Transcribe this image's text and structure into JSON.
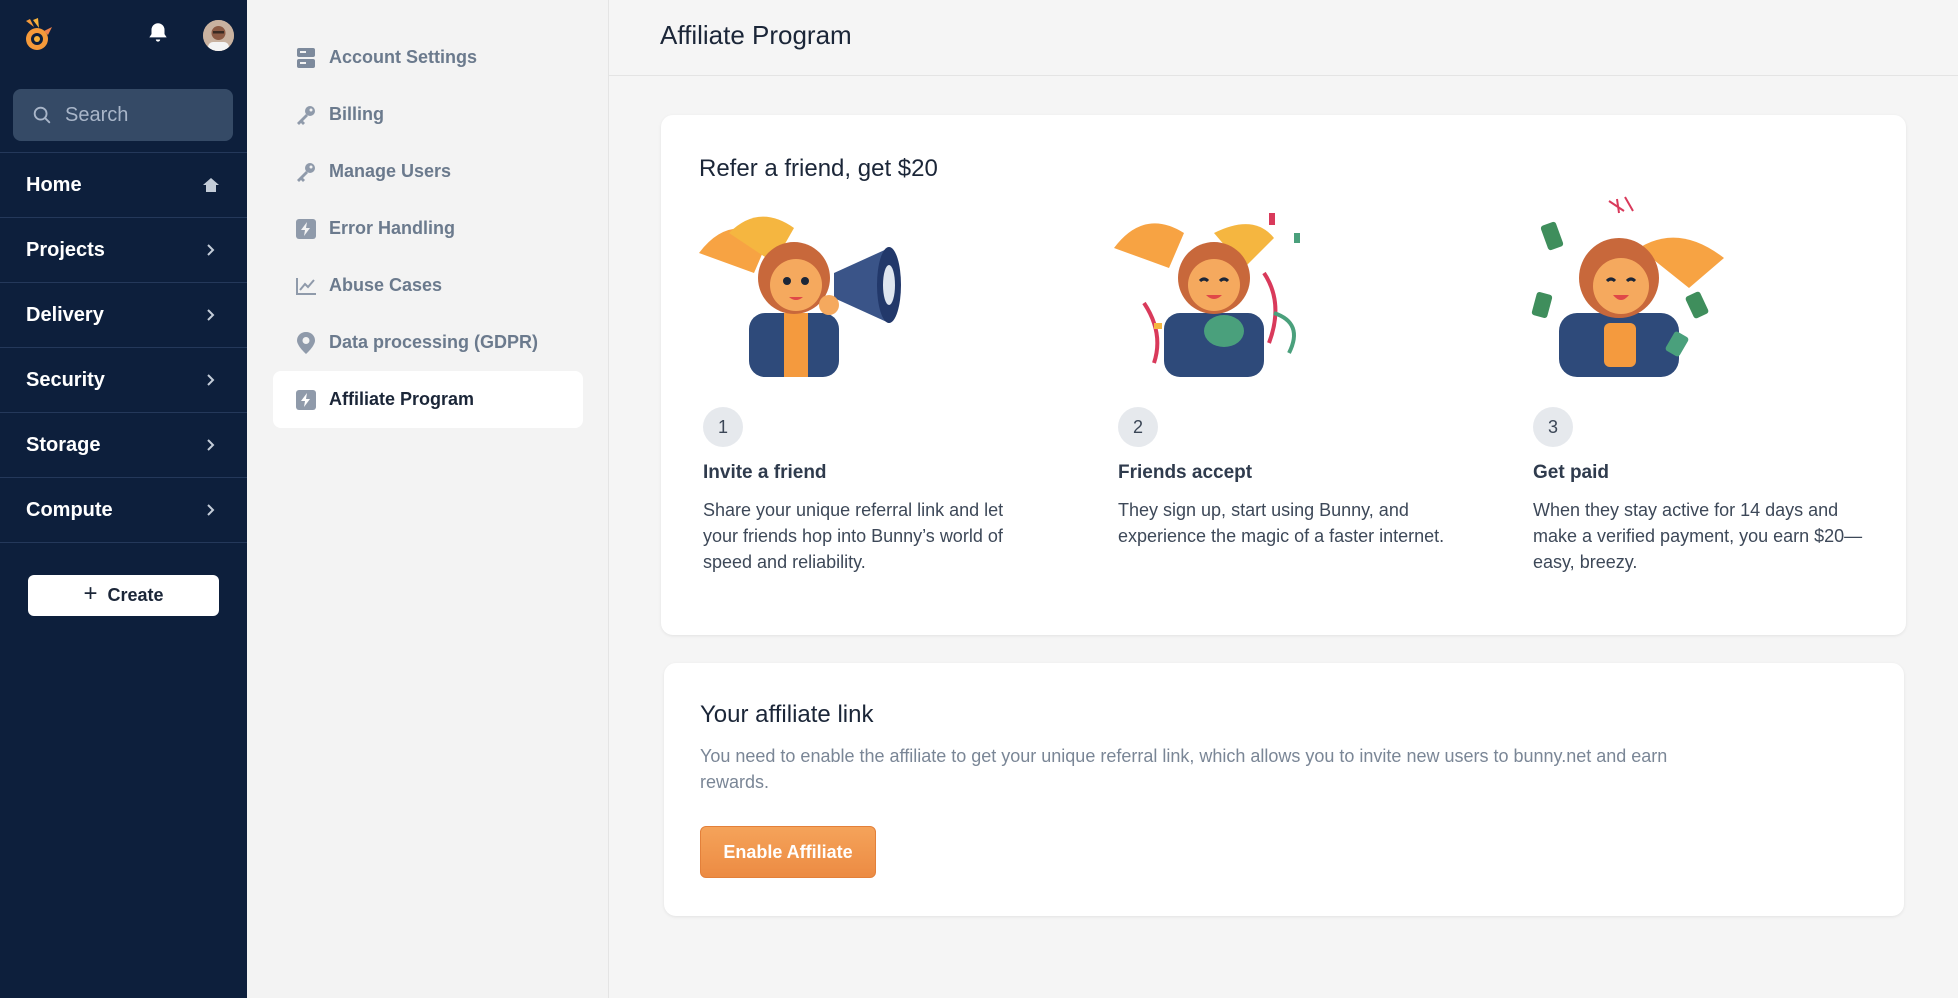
{
  "colors": {
    "sidebar": "#0d1f3c",
    "accent": "#ef9446",
    "page_bg": "#f5f5f5"
  },
  "sidebar": {
    "logo": "bunny-logo",
    "notifications_icon": "bell-icon",
    "avatar": "user-avatar",
    "search": {
      "placeholder": "Search",
      "icon": "search-icon"
    },
    "nav": [
      {
        "label": "Home",
        "icon": "home-icon"
      },
      {
        "label": "Projects",
        "icon": "chevron-right-icon"
      },
      {
        "label": "Delivery",
        "icon": "chevron-right-icon"
      },
      {
        "label": "Security",
        "icon": "chevron-right-icon"
      },
      {
        "label": "Storage",
        "icon": "chevron-right-icon"
      },
      {
        "label": "Compute",
        "icon": "chevron-right-icon"
      }
    ],
    "create": {
      "label": "Create",
      "icon": "plus-icon"
    }
  },
  "settings_menu": [
    {
      "label": "Account Settings",
      "icon": "server-icon"
    },
    {
      "label": "Billing",
      "icon": "key-icon"
    },
    {
      "label": "Manage Users",
      "icon": "key-icon"
    },
    {
      "label": "Error Handling",
      "icon": "bolt-icon"
    },
    {
      "label": "Abuse Cases",
      "icon": "line-chart-icon"
    },
    {
      "label": "Data processing (GDPR)",
      "icon": "map-pin-icon"
    },
    {
      "label": "Affiliate Program",
      "icon": "bolt-icon",
      "active": true
    }
  ],
  "page": {
    "title": "Affiliate Program"
  },
  "refer": {
    "title": "Refer a friend, get $20",
    "steps": [
      {
        "number": "1",
        "title": "Invite a friend",
        "text": "Share your unique referral link and let your friends hop into Bunny’s world of speed and reliability.",
        "illustration": "bunny-megaphone-illustration"
      },
      {
        "number": "2",
        "title": "Friends accept",
        "text": "They sign up, start using Bunny, and experience the magic of a faster internet.",
        "illustration": "bunny-confetti-illustration"
      },
      {
        "number": "3",
        "title": "Get paid",
        "text": "When they stay active for 14 days and make a verified payment, you earn $20—easy, breezy.",
        "illustration": "bunny-money-illustration"
      }
    ]
  },
  "affiliate_link": {
    "title": "Your affiliate link",
    "description": "You need to enable the affiliate to get your unique referral link, which allows you to invite new users to bunny.net and earn rewards.",
    "button": "Enable Affiliate"
  }
}
